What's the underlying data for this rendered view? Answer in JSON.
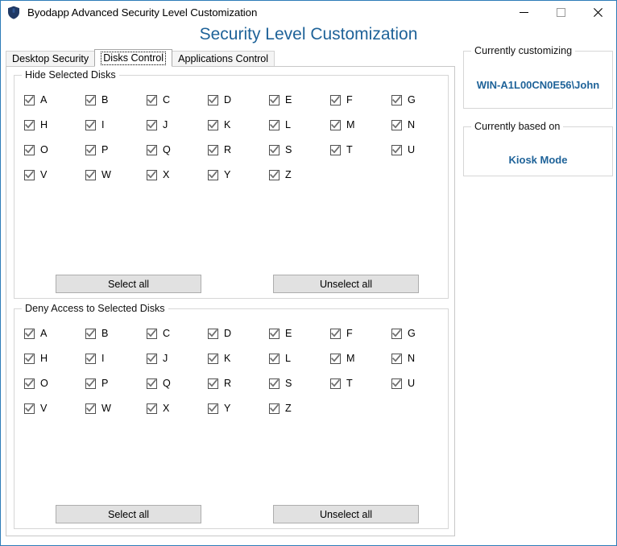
{
  "window": {
    "title": "Byodapp Advanced Security Level Customization",
    "icon": "shield-icon",
    "controls": {
      "minimize": "minimize-icon",
      "maximize": "maximize-icon",
      "close": "close-icon"
    },
    "border_color": "#2e7cb8"
  },
  "header": {
    "title": "Security Level Customization",
    "color": "#1f6399"
  },
  "tabs": [
    {
      "label": "Desktop Security",
      "active": false
    },
    {
      "label": "Disks Control",
      "active": true
    },
    {
      "label": "Applications Control",
      "active": false
    }
  ],
  "groups": [
    {
      "id": "hide",
      "label": "Hide Selected Disks",
      "drives": [
        {
          "letter": "A",
          "checked": true
        },
        {
          "letter": "B",
          "checked": true
        },
        {
          "letter": "C",
          "checked": true
        },
        {
          "letter": "D",
          "checked": true
        },
        {
          "letter": "E",
          "checked": true
        },
        {
          "letter": "F",
          "checked": true
        },
        {
          "letter": "G",
          "checked": true
        },
        {
          "letter": "H",
          "checked": true
        },
        {
          "letter": "I",
          "checked": true
        },
        {
          "letter": "J",
          "checked": true
        },
        {
          "letter": "K",
          "checked": true
        },
        {
          "letter": "L",
          "checked": true
        },
        {
          "letter": "M",
          "checked": true
        },
        {
          "letter": "N",
          "checked": true
        },
        {
          "letter": "O",
          "checked": true
        },
        {
          "letter": "P",
          "checked": true
        },
        {
          "letter": "Q",
          "checked": true
        },
        {
          "letter": "R",
          "checked": true
        },
        {
          "letter": "S",
          "checked": true
        },
        {
          "letter": "T",
          "checked": true
        },
        {
          "letter": "U",
          "checked": true
        },
        {
          "letter": "V",
          "checked": true
        },
        {
          "letter": "W",
          "checked": true
        },
        {
          "letter": "X",
          "checked": true
        },
        {
          "letter": "Y",
          "checked": true
        },
        {
          "letter": "Z",
          "checked": true
        }
      ],
      "select_all_label": "Select all",
      "unselect_all_label": "Unselect all"
    },
    {
      "id": "deny",
      "label": "Deny Access to Selected Disks",
      "drives": [
        {
          "letter": "A",
          "checked": true
        },
        {
          "letter": "B",
          "checked": true
        },
        {
          "letter": "C",
          "checked": true
        },
        {
          "letter": "D",
          "checked": true
        },
        {
          "letter": "E",
          "checked": true
        },
        {
          "letter": "F",
          "checked": true
        },
        {
          "letter": "G",
          "checked": true
        },
        {
          "letter": "H",
          "checked": true
        },
        {
          "letter": "I",
          "checked": true
        },
        {
          "letter": "J",
          "checked": true
        },
        {
          "letter": "K",
          "checked": true
        },
        {
          "letter": "L",
          "checked": true
        },
        {
          "letter": "M",
          "checked": true
        },
        {
          "letter": "N",
          "checked": true
        },
        {
          "letter": "O",
          "checked": true
        },
        {
          "letter": "P",
          "checked": true
        },
        {
          "letter": "Q",
          "checked": true
        },
        {
          "letter": "R",
          "checked": true
        },
        {
          "letter": "S",
          "checked": true
        },
        {
          "letter": "T",
          "checked": true
        },
        {
          "letter": "U",
          "checked": true
        },
        {
          "letter": "V",
          "checked": true
        },
        {
          "letter": "W",
          "checked": true
        },
        {
          "letter": "X",
          "checked": true
        },
        {
          "letter": "Y",
          "checked": true
        },
        {
          "letter": "Z",
          "checked": true
        }
      ],
      "select_all_label": "Select all",
      "unselect_all_label": "Unselect all"
    }
  ],
  "sidebar": {
    "customizing": {
      "label": "Currently customizing",
      "value": "WIN-A1L00CN0E56\\John"
    },
    "based_on": {
      "label": "Currently based on",
      "value": "Kiosk Mode"
    }
  }
}
